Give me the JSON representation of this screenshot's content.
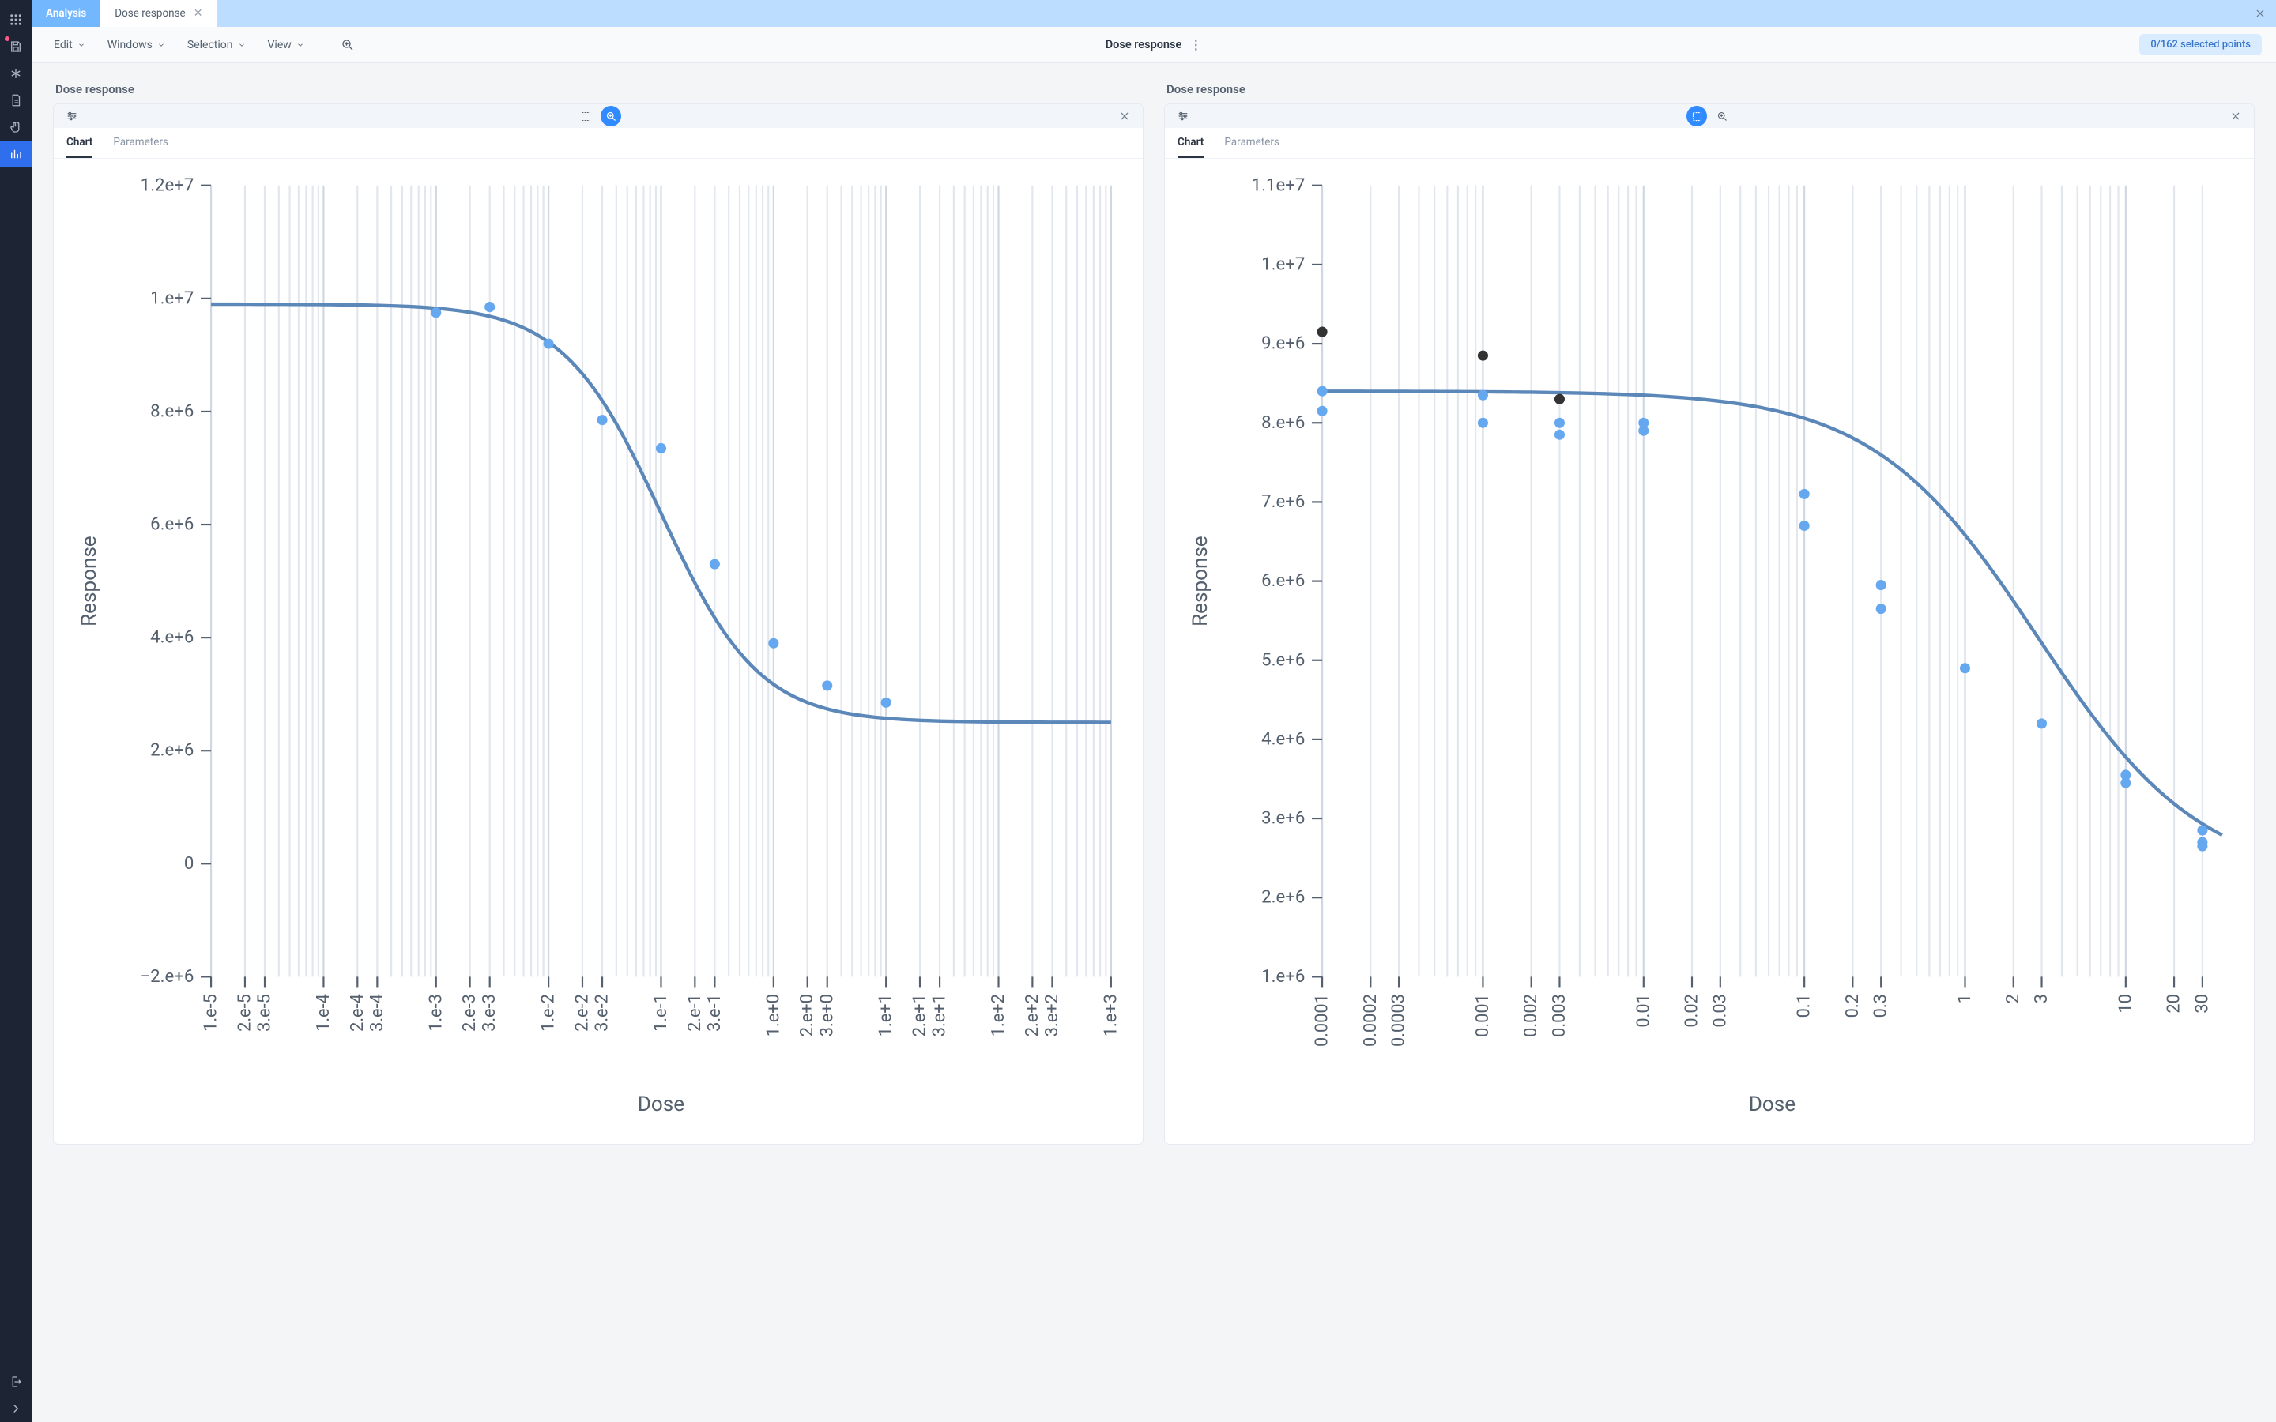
{
  "sidebar": {
    "icons": [
      "apps",
      "save",
      "asterisk",
      "document",
      "hand",
      "analysis",
      "logout",
      "expand"
    ]
  },
  "top": {
    "primary_tab": "Analysis",
    "document_tab": "Dose response"
  },
  "menu": {
    "items": [
      "Edit",
      "Windows",
      "Selection",
      "View"
    ],
    "center_title": "Dose response",
    "selection_pill": "0/162 selected points"
  },
  "panels": [
    {
      "title": "Dose response",
      "toolbar": {
        "zoom_active": true,
        "select_active": false
      },
      "tabs": [
        "Chart",
        "Parameters"
      ],
      "active_tab": 0,
      "chart_id": 0
    },
    {
      "title": "Dose response",
      "toolbar": {
        "zoom_active": false,
        "select_active": true
      },
      "tabs": [
        "Chart",
        "Parameters"
      ],
      "active_tab": 0,
      "chart_id": 1
    }
  ],
  "chart_data": [
    {
      "type": "scatter",
      "xlabel": "Dose",
      "ylabel": "Response",
      "xscale": "log",
      "xlim_exp": [
        -5,
        3
      ],
      "ylim": [
        -2000000,
        12000000
      ],
      "y_ticks": [
        {
          "v": -2000000,
          "lbl": "−2.e+6"
        },
        {
          "v": 0,
          "lbl": "0"
        },
        {
          "v": 2000000,
          "lbl": "2.e+6"
        },
        {
          "v": 4000000,
          "lbl": "4.e+6"
        },
        {
          "v": 6000000,
          "lbl": "6.e+6"
        },
        {
          "v": 8000000,
          "lbl": "8.e+6"
        },
        {
          "v": 10000000,
          "lbl": "1.e+7"
        },
        {
          "v": 12000000,
          "lbl": "1.2e+7"
        }
      ],
      "x_tick_labels_by_exp": {
        "-5": "1.e-5",
        "-4": "1.e-4",
        "-3": "1.e-3",
        "-2": "1.e-2",
        "-1": "1.e-1",
        "0": "1.e+0",
        "1": "1.e+1",
        "2": "1.e+2",
        "3": "1.e+3"
      },
      "x_tick_labels_23_by_exp": {
        "-5": [
          "2.e-5",
          "3.e-5"
        ],
        "-4": [
          "2.e-4",
          "3.e-4"
        ],
        "-3": [
          "2.e-3",
          "3.e-3"
        ],
        "-2": [
          "2.e-2",
          "3.e-2"
        ],
        "-1": [
          "2.e-1",
          "3.e-1"
        ],
        "0": [
          "2.e+0",
          "3.e+0"
        ],
        "1": [
          "2.e+1",
          "3.e+1"
        ],
        "2": [
          "2.e+2",
          "3.e+2"
        ]
      },
      "curve": {
        "top": 9900000,
        "bottom": 2500000,
        "logEC50": -1.0,
        "hill": 1.0
      },
      "points": [
        {
          "x": 0.001,
          "y": 9750000
        },
        {
          "x": 0.003,
          "y": 9850000
        },
        {
          "x": 0.01,
          "y": 9200000
        },
        {
          "x": 0.03,
          "y": 7850000
        },
        {
          "x": 0.1,
          "y": 7350000
        },
        {
          "x": 0.3,
          "y": 5300000
        },
        {
          "x": 1.0,
          "y": 3900000
        },
        {
          "x": 3.0,
          "y": 3150000
        },
        {
          "x": 10.0,
          "y": 2850000
        }
      ]
    },
    {
      "type": "scatter",
      "xlabel": "Dose",
      "ylabel": "Response",
      "xscale": "log",
      "xlim_exp": [
        -4,
        1.6
      ],
      "ylim": [
        1000000,
        11000000
      ],
      "y_ticks": [
        {
          "v": 1000000,
          "lbl": "1.e+6"
        },
        {
          "v": 2000000,
          "lbl": "2.e+6"
        },
        {
          "v": 3000000,
          "lbl": "3.e+6"
        },
        {
          "v": 4000000,
          "lbl": "4.e+6"
        },
        {
          "v": 5000000,
          "lbl": "5.e+6"
        },
        {
          "v": 6000000,
          "lbl": "6.e+6"
        },
        {
          "v": 7000000,
          "lbl": "7.e+6"
        },
        {
          "v": 8000000,
          "lbl": "8.e+6"
        },
        {
          "v": 9000000,
          "lbl": "9.e+6"
        },
        {
          "v": 10000000,
          "lbl": "1.e+7"
        },
        {
          "v": 11000000,
          "lbl": "1.1e+7"
        }
      ],
      "x_tick_labels_by_exp": {
        "-4": "0.0001",
        "-3": "0.001",
        "-2": "0.01",
        "-1": "0.1",
        "0": "1",
        "1": "10"
      },
      "x_tick_labels_23_by_exp": {
        "-4": [
          "0.0002",
          "0.0003"
        ],
        "-3": [
          "0.002",
          "0.003"
        ],
        "-2": [
          "0.02",
          "0.03"
        ],
        "-1": [
          "0.2",
          "0.3"
        ],
        "0": [
          "2",
          "3"
        ],
        "1": [
          "20",
          "30"
        ]
      },
      "curve": {
        "top": 8400000,
        "bottom": 2200000,
        "logEC50": 0.45,
        "hill": 0.85
      },
      "points_blue": [
        {
          "x": 0.0001,
          "y": 8400000
        },
        {
          "x": 0.0001,
          "y": 8150000
        },
        {
          "x": 0.001,
          "y": 8350000
        },
        {
          "x": 0.001,
          "y": 8000000
        },
        {
          "x": 0.003,
          "y": 8000000
        },
        {
          "x": 0.003,
          "y": 7850000
        },
        {
          "x": 0.01,
          "y": 8000000
        },
        {
          "x": 0.01,
          "y": 7900000
        },
        {
          "x": 0.1,
          "y": 7100000
        },
        {
          "x": 0.1,
          "y": 6700000
        },
        {
          "x": 0.3,
          "y": 5950000
        },
        {
          "x": 0.3,
          "y": 5650000
        },
        {
          "x": 1,
          "y": 4900000
        },
        {
          "x": 3,
          "y": 4200000
        },
        {
          "x": 10,
          "y": 3550000
        },
        {
          "x": 10,
          "y": 3450000
        },
        {
          "x": 30,
          "y": 2850000
        },
        {
          "x": 30,
          "y": 2700000
        },
        {
          "x": 30,
          "y": 2650000
        }
      ],
      "points_black": [
        {
          "x": 0.0001,
          "y": 9150000
        },
        {
          "x": 0.001,
          "y": 8850000
        },
        {
          "x": 0.003,
          "y": 8300000
        }
      ]
    }
  ]
}
